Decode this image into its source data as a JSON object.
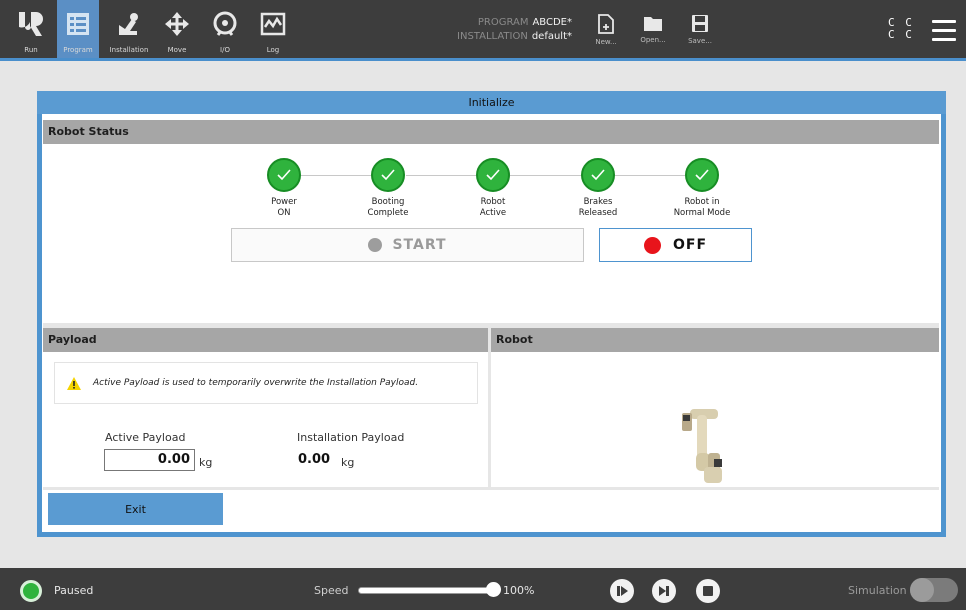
{
  "header": {
    "nav": [
      {
        "label": "Run",
        "icon": "ur-logo-icon"
      },
      {
        "label": "Program",
        "icon": "program-icon",
        "active": true
      },
      {
        "label": "Installation",
        "icon": "installation-icon"
      },
      {
        "label": "Move",
        "icon": "move-icon"
      },
      {
        "label": "I/O",
        "icon": "io-icon"
      },
      {
        "label": "Log",
        "icon": "log-icon"
      }
    ],
    "program_label": "PROGRAM",
    "program_value": "ABCDE*",
    "installation_label": "INSTALLATION",
    "installation_value": "default*",
    "files": [
      {
        "label": "New...",
        "icon": "new-file-icon"
      },
      {
        "label": "Open...",
        "icon": "open-folder-icon"
      },
      {
        "label": "Save...",
        "icon": "save-icon"
      }
    ],
    "cc_top": "C C",
    "cc_bottom": "C C",
    "accent_color": "#4a8fcc"
  },
  "dialog": {
    "title": "Initialize",
    "robot_status": {
      "heading": "Robot Status",
      "steps": [
        {
          "line1": "Power",
          "line2": "ON"
        },
        {
          "line1": "Booting",
          "line2": "Complete"
        },
        {
          "line1": "Robot",
          "line2": "Active"
        },
        {
          "line1": "Brakes",
          "line2": "Released"
        },
        {
          "line1": "Robot in",
          "line2": "Normal Mode"
        }
      ],
      "start_label": "START",
      "off_label": "OFF",
      "step_color": "#2fb33d",
      "off_color": "#e8141b"
    },
    "payload": {
      "heading": "Payload",
      "warning": "Active Payload is used to temporarily overwrite the Installation Payload.",
      "active_label": "Active Payload",
      "active_value": "0.00",
      "active_unit": "kg",
      "installation_label": "Installation Payload",
      "installation_value": "0.00",
      "installation_unit": "kg"
    },
    "robot": {
      "heading": "Robot"
    },
    "exit_label": "Exit"
  },
  "footer": {
    "status": "Paused",
    "speed_label": "Speed",
    "speed_value": "100%",
    "speed_fraction": 1.0,
    "simulation_label": "Simulation"
  }
}
